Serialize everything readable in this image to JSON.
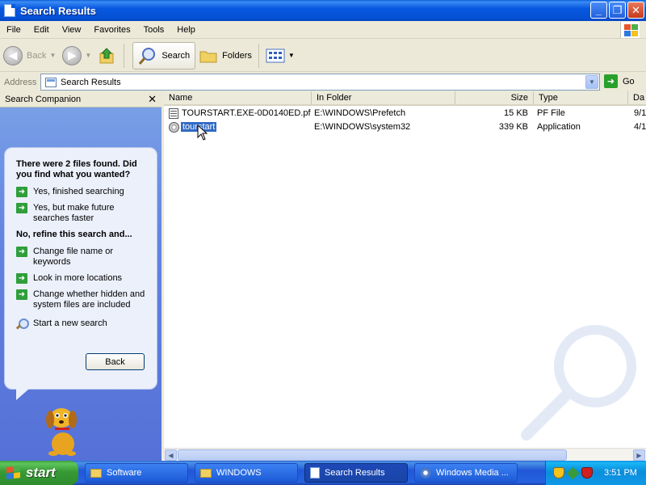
{
  "window": {
    "title": "Search Results",
    "controls": [
      "_",
      "❐",
      "✕"
    ]
  },
  "menu": [
    "File",
    "Edit",
    "View",
    "Favorites",
    "Tools",
    "Help"
  ],
  "toolbar": {
    "back": "Back",
    "search": "Search",
    "folders": "Folders"
  },
  "address": {
    "label": "Address",
    "value": "Search Results",
    "go": "Go"
  },
  "search_companion": {
    "header": "Search Companion",
    "close": "✕",
    "found_text": "There were 2 files found. Did you find what you wanted?",
    "options_a": [
      "Yes, finished searching",
      "Yes, but make future searches faster"
    ],
    "refine_heading": "No, refine this search and...",
    "options_b": [
      "Change file name or keywords",
      "Look in more locations",
      "Change whether hidden and system files are included"
    ],
    "new_search": "Start a new search",
    "back_button": "Back"
  },
  "list": {
    "columns": [
      "Name",
      "In Folder",
      "Size",
      "Type",
      "Da"
    ],
    "rows": [
      {
        "name": "TOURSTART.EXE-0D0140ED.pf",
        "folder": "E:\\WINDOWS\\Prefetch",
        "size": "15 KB",
        "type": "PF File",
        "date": "9/1",
        "selected": false
      },
      {
        "name": "tourstart",
        "folder": "E:\\WINDOWS\\system32",
        "size": "339 KB",
        "type": "Application",
        "date": "4/1",
        "selected": true
      }
    ]
  },
  "taskbar": {
    "start": "start",
    "tasks": [
      "Software",
      "WINDOWS",
      "Search Results",
      "Windows Media ..."
    ],
    "active_task": "Search Results",
    "clock": "3:51 PM"
  },
  "colors": {
    "title_blue": "#0550d4",
    "pane_blue": "#6384e0",
    "selection": "#316ac5",
    "start_green": "#3c9f3b",
    "arrow_green": "#2f9e3b"
  }
}
